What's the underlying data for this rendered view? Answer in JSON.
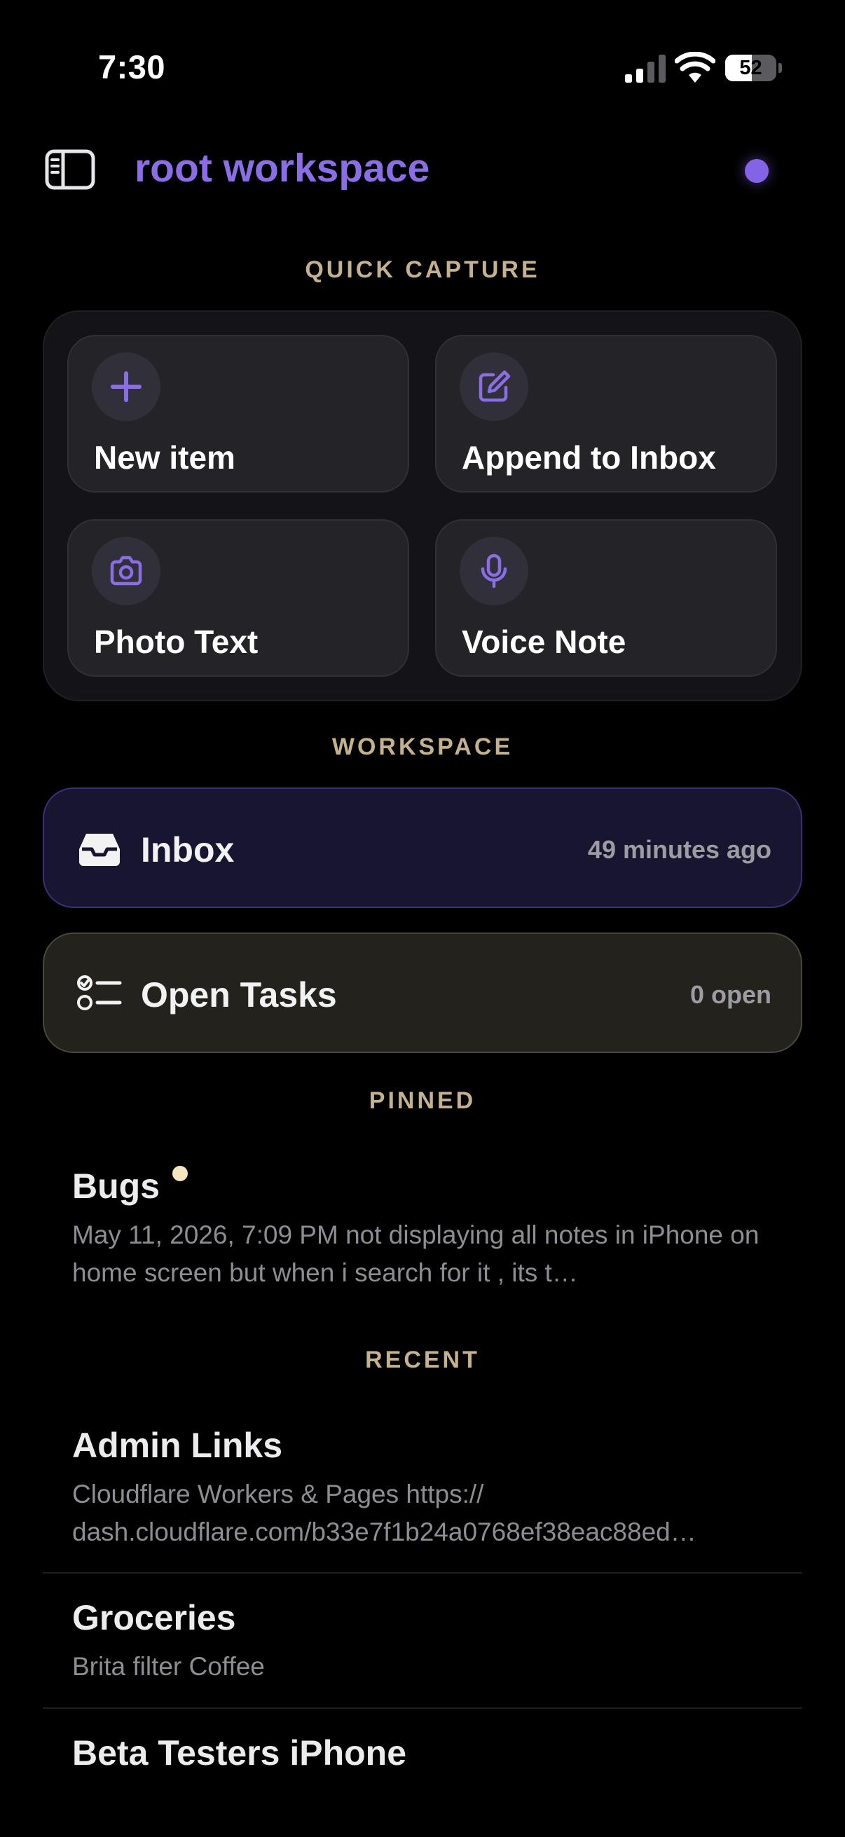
{
  "status_bar": {
    "time": "7:30",
    "battery_level": "52",
    "battery_fraction": 0.52
  },
  "header": {
    "workspace_title": "root workspace",
    "accent_color": "#8b6ee6",
    "sidebar_icon": "sidebar-icon",
    "status_indicator_color": "#8464e6"
  },
  "quick_capture": {
    "section_label": "QUICK CAPTURE",
    "tiles": [
      {
        "label": "New item",
        "icon": "plus-icon"
      },
      {
        "label": "Append to Inbox",
        "icon": "compose-icon"
      },
      {
        "label": "Photo Text",
        "icon": "camera-icon"
      },
      {
        "label": "Voice Note",
        "icon": "microphone-icon"
      }
    ]
  },
  "workspace": {
    "section_label": "WORKSPACE",
    "cards": [
      {
        "label": "Inbox",
        "meta": "49 minutes ago",
        "icon": "inbox-tray-icon",
        "color": "#3c2f7a"
      },
      {
        "label": "Open Tasks",
        "meta": "0 open",
        "icon": "checklist-icon",
        "color": "#494738"
      }
    ]
  },
  "pinned": {
    "section_label": "PINNED",
    "items": [
      {
        "title": "Bugs",
        "preview": "May 11, 2026, 7:09 PM not displaying all notes in iPhone on home screen but when i search for it , its t…"
      }
    ]
  },
  "recent": {
    "section_label": "RECENT",
    "items": [
      {
        "title": "Admin Links",
        "preview": "Cloudflare Workers & Pages https://\ndash.cloudflare.com/b33e7f1b24a0768ef38eac88ed…"
      },
      {
        "title": "Groceries",
        "preview": "Brita filter Coffee"
      },
      {
        "title": "Beta Testers iPhone",
        "preview": ""
      }
    ]
  }
}
